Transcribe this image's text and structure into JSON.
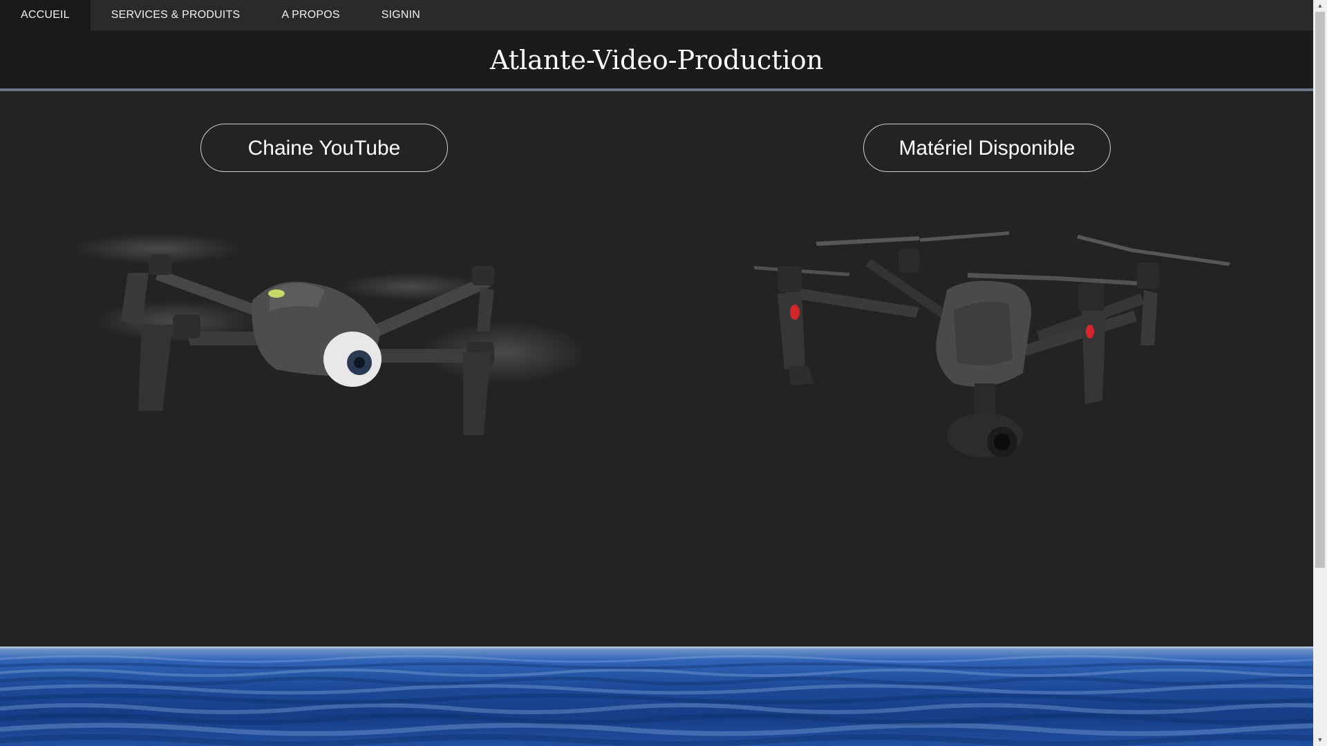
{
  "nav": {
    "items": [
      {
        "label": "ACCUEIL",
        "active": true
      },
      {
        "label": "SERVICES & PRODUITS",
        "active": false
      },
      {
        "label": "A PROPOS",
        "active": false
      },
      {
        "label": "SIGNIN",
        "active": false
      }
    ]
  },
  "header": {
    "title": "Atlante-Video-Production"
  },
  "buttons": {
    "youtube_label": "Chaine YouTube",
    "materiel_label": "Matériel Disponible"
  },
  "colors": {
    "background": "#232323",
    "nav_bg": "#2a2a2a",
    "header_bg": "#1b1b1b",
    "header_border": "#6f7587",
    "water": "#1d4a98"
  },
  "scrollbar": {
    "up_icon": "▲",
    "down_icon": "▼"
  }
}
